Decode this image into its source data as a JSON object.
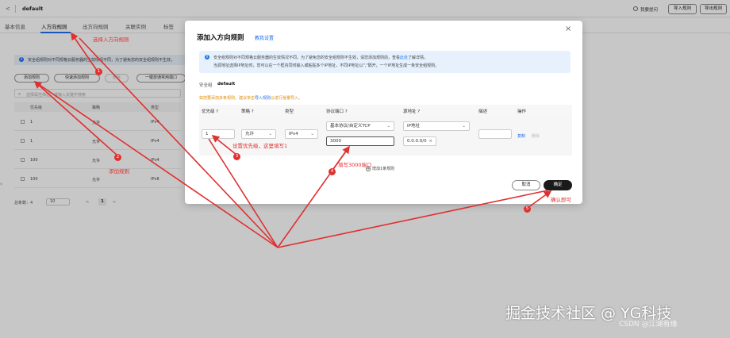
{
  "header": {
    "back_glyph": "<",
    "title": "default",
    "feedback_label": "我要提问",
    "import_label": "导入规则",
    "export_label": "导出规则"
  },
  "tabs": [
    {
      "label": "基本信息"
    },
    {
      "label": "入方向规则"
    },
    {
      "label": "出方向规则"
    },
    {
      "label": "关联实例"
    },
    {
      "label": "标签"
    }
  ],
  "background": {
    "info_text": "安全组规则对不同规格云服务器的生效情况不同，为了避免您的安全组规则不生效，",
    "buttons": [
      "添加规则",
      "快速添加规则",
      "删除",
      "一键放通常用端口"
    ],
    "search_placeholder": "选择属性筛选，或输入关键字搜索",
    "columns": [
      "优先级",
      "策略",
      "类型"
    ],
    "rows": [
      {
        "priority": "1",
        "action": "允许",
        "type": "IPv4"
      },
      {
        "priority": "1",
        "action": "允许",
        "type": "IPv4"
      },
      {
        "priority": "100",
        "action": "允许",
        "type": "IPv4"
      },
      {
        "priority": "100",
        "action": "允许",
        "type": "IPv6"
      }
    ],
    "pager_total": "总条数：4",
    "pager_size": "10",
    "pager_prev": "<",
    "pager_page": "1",
    "pager_next": ">"
  },
  "dialog": {
    "title": "添加入方向规则",
    "tutorial_link": "教我设置",
    "close_glyph": "×",
    "info_line1_prefix": "安全组规则对不同规格云服务器的生效情况不同，为了避免您的安全组规则不生效，请您添加规则前，查看",
    "info_line1_link": "此处",
    "info_line1_suffix": "了解详情。",
    "info_line2": "当源地址选择IP地址时，您可以在一个框内同时输入或粘贴多个IP地址，不同IP地址以\",\"隔开，一个IP地址生成一条安全组规则。",
    "sg_label": "安全组",
    "sg_value": "default",
    "warn_prefix": "如您要添加多条规则，建议单击",
    "warn_link": "导入规则",
    "warn_suffix": "以进行批量导入。",
    "columns": [
      "优先级 ?",
      "策略 ?",
      "类型",
      "协议端口 ?",
      "源地址 ?",
      "描述",
      "操作"
    ],
    "row": {
      "priority": "1",
      "action": "允许",
      "type": "IPv4",
      "protocol": "基本协议/自定义TCP",
      "port": "3000",
      "source_type": "IP地址",
      "source_ip": "0.0.0.0/0",
      "description": "",
      "op_copy": "复制",
      "op_delete": "删除"
    },
    "add_rule": "增加1条规则",
    "cancel_label": "取消",
    "ok_label": "确定"
  },
  "annotations": {
    "a1_text": "选择入方向规则",
    "a1_num": "1",
    "a2_text": "添加规则",
    "a2_num": "2",
    "a3_text": "设置优先级，这里填写1",
    "a3_num": "3",
    "a4_text": "填写3000端口",
    "a4_num": "4",
    "a5_text": "确认即可",
    "a5_num": "5",
    "color": "#e03030"
  },
  "watermark": {
    "main": "掘金技术社区 @ YG科技",
    "sub": "CSDN @江湖有缘"
  },
  "colors": {
    "accent": "#1f6feb",
    "primary_button": "#1a1a1a",
    "warn": "#e08a00"
  }
}
